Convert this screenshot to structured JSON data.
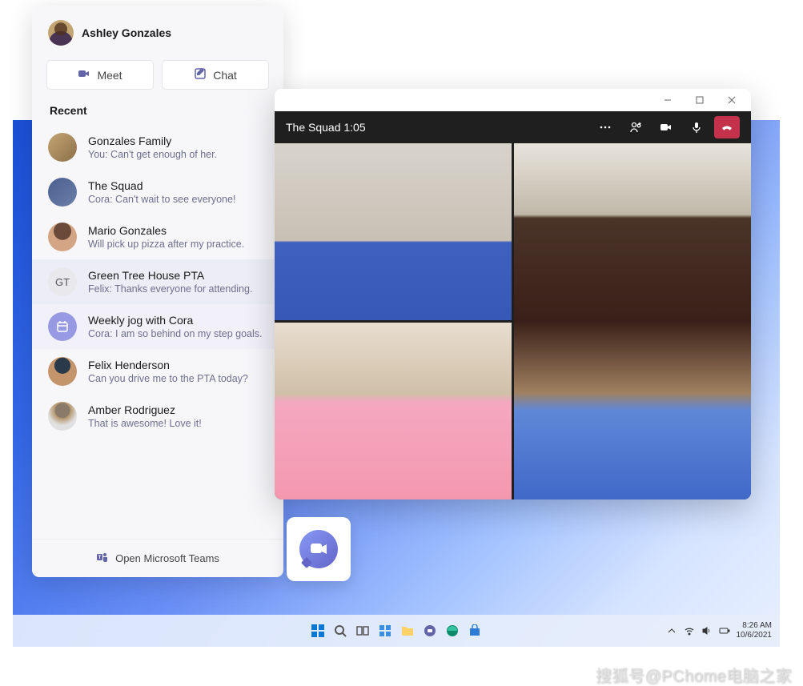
{
  "user": {
    "name": "Ashley Gonzales"
  },
  "buttons": {
    "meet": "Meet",
    "chat": "Chat"
  },
  "recent": {
    "label": "Recent",
    "items": [
      {
        "title": "Gonzales Family",
        "preview": "You: Can't get enough of her."
      },
      {
        "title": "The Squad",
        "preview": "Cora: Can't wait to see everyone!"
      },
      {
        "title": "Mario Gonzales",
        "preview": "Will pick up pizza after my practice."
      },
      {
        "title": "Green Tree House PTA",
        "preview": "Felix: Thanks everyone for attending."
      },
      {
        "title": "Weekly jog with Cora",
        "preview": "Cora: I am so behind on my step goals."
      },
      {
        "title": "Felix Henderson",
        "preview": "Can you drive me to the PTA today?"
      },
      {
        "title": "Amber Rodriguez",
        "preview": "That is awesome! Love it!"
      }
    ]
  },
  "initials": {
    "gt": "GT"
  },
  "footer": {
    "open_teams": "Open Microsoft Teams"
  },
  "call": {
    "title": "The Squad 1:05"
  },
  "taskbar": {
    "time": "8:26 AM",
    "date": "10/6/2021"
  },
  "watermark": "搜狐号@PChome电脑之家"
}
